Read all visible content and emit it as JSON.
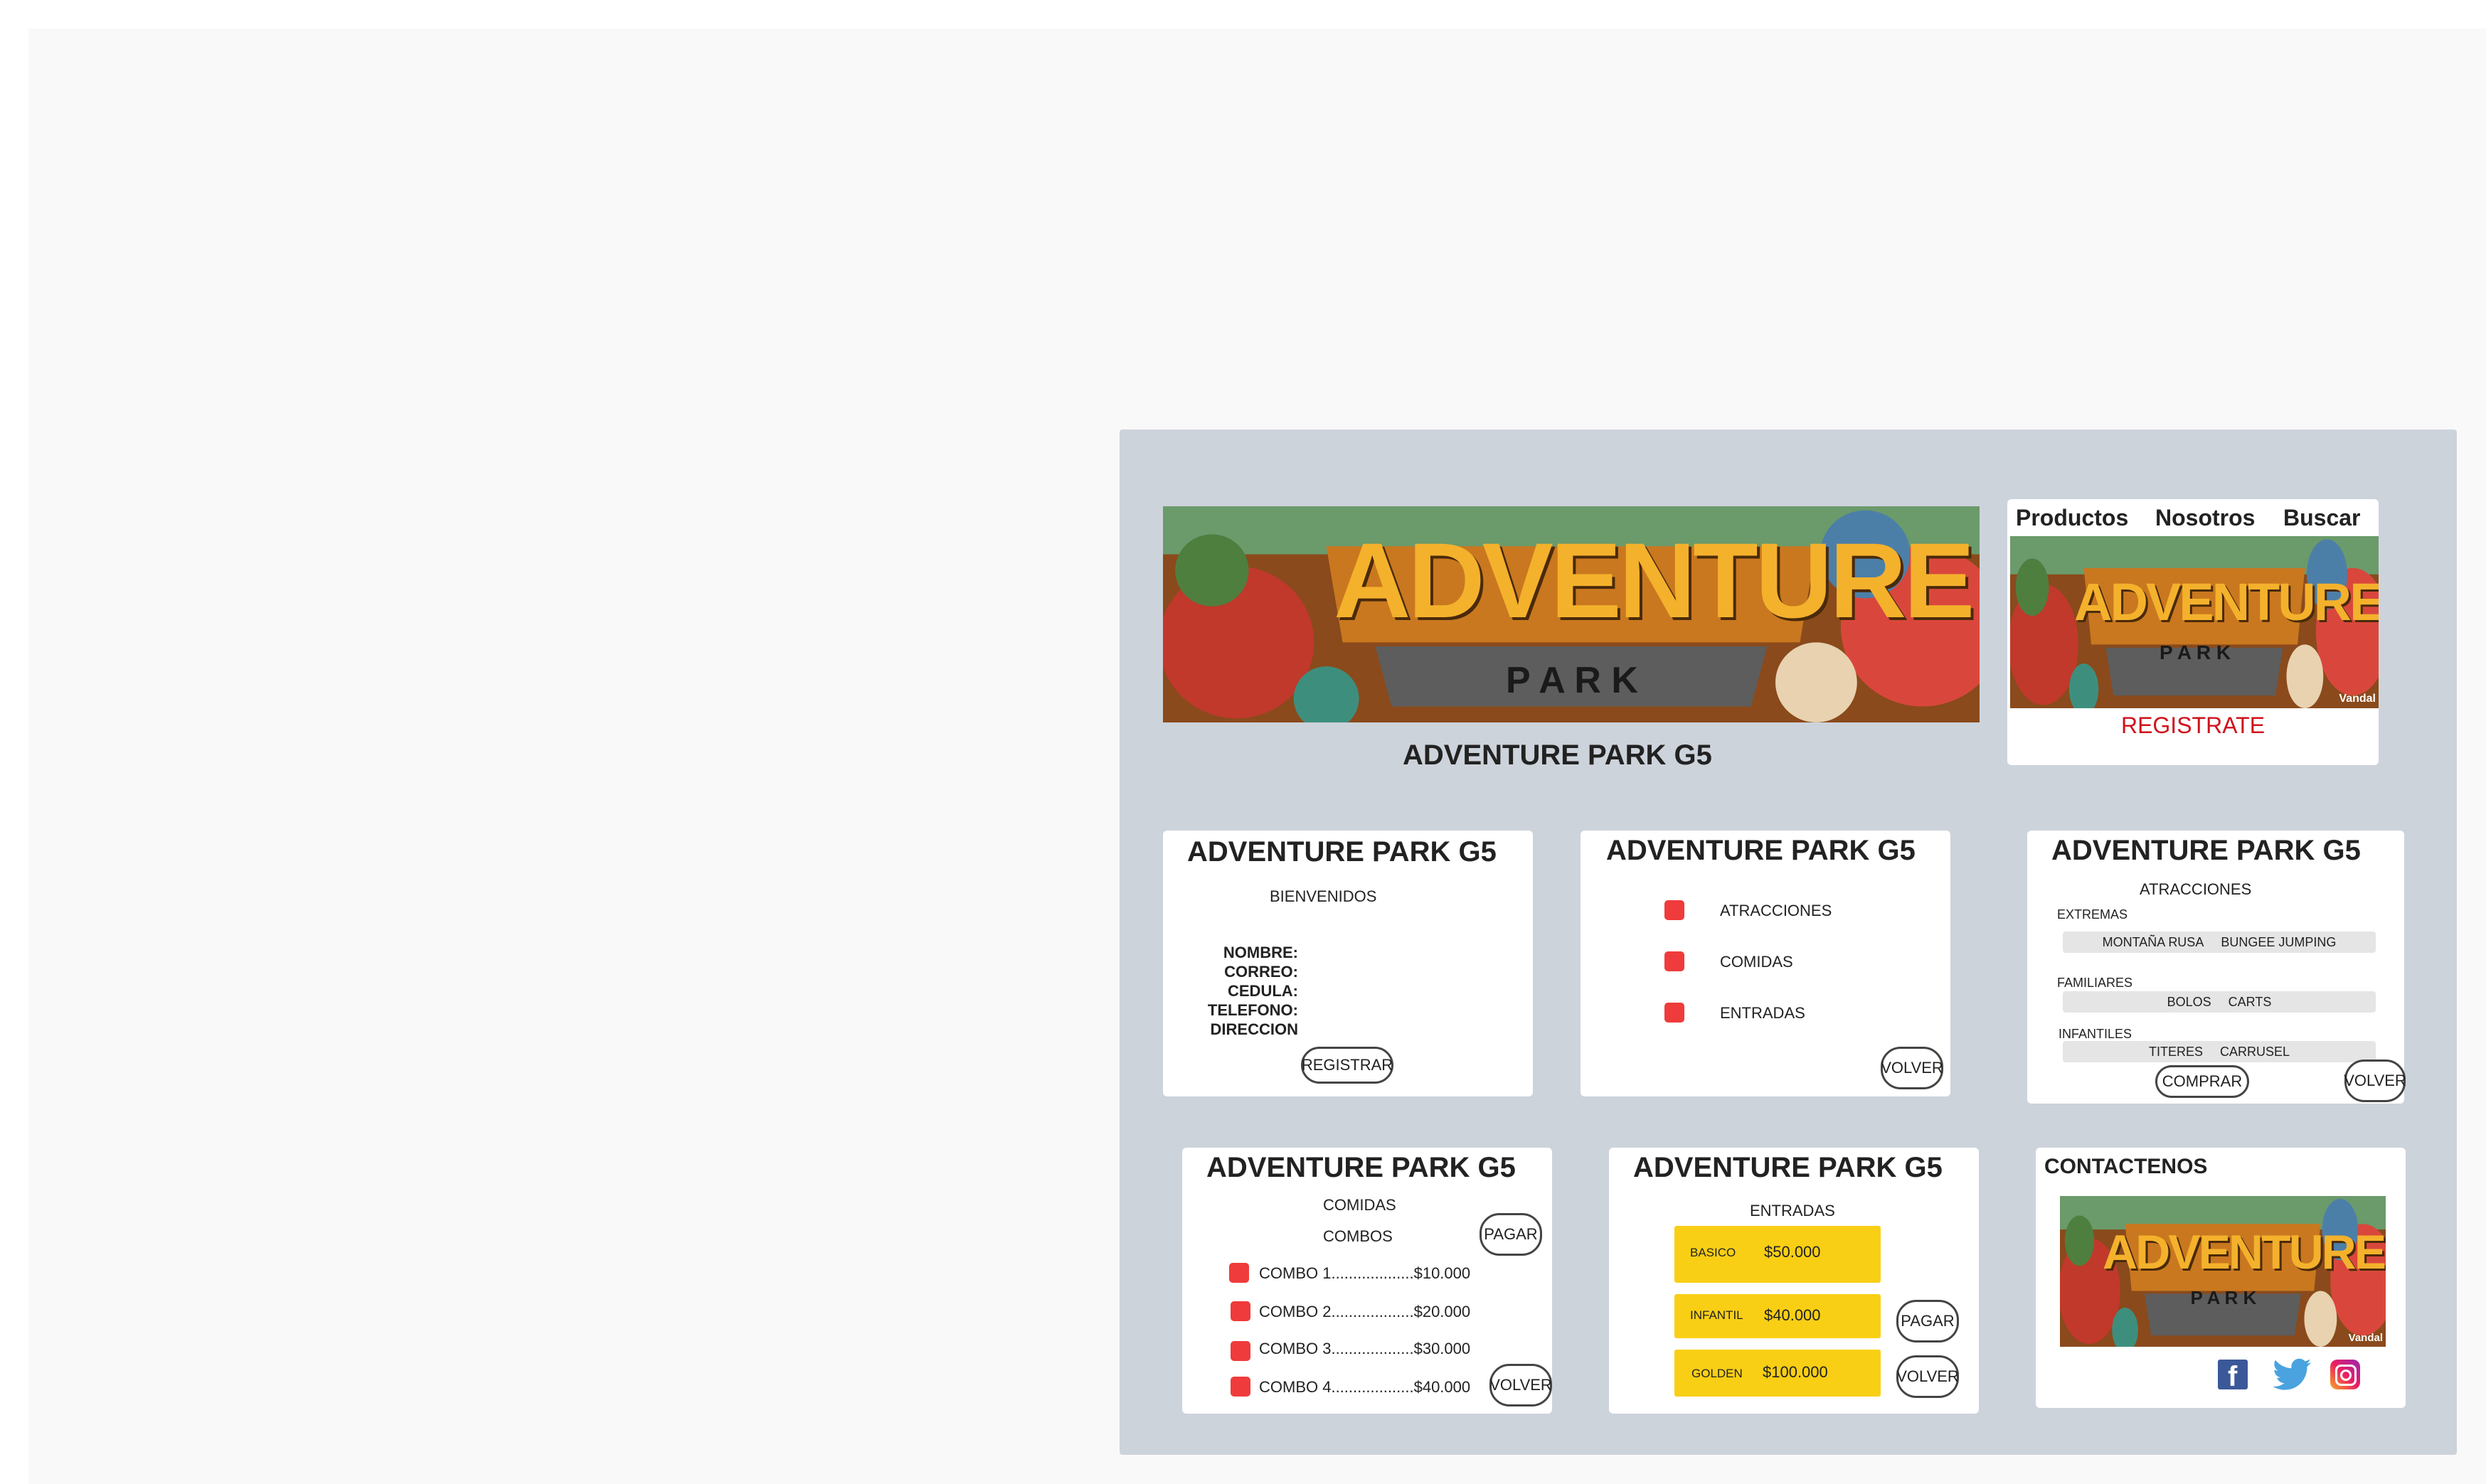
{
  "site_name": "ADVENTURE PARK G5",
  "banner": {
    "logo_main": "ADVENTURE",
    "logo_sub": "P A R K",
    "watermark": "Vandal"
  },
  "nav": {
    "productos": "Productos",
    "nosotros": "Nosotros",
    "buscar": "Buscar"
  },
  "register_link": "REGISTRATE",
  "registro": {
    "welcome": "BIENVENIDOS",
    "fields": [
      "NOMBRE:",
      "CORREO:",
      "CEDULA:",
      "TELEFONO:",
      "DIRECCION"
    ],
    "button": "REGISTRAR"
  },
  "menu": {
    "items": [
      "ATRACCIONES",
      "COMIDAS",
      "ENTRADAS"
    ],
    "back_button": "VOLVER"
  },
  "atracciones": {
    "heading": "ATRACCIONES",
    "extremas": {
      "label": "EXTREMAS",
      "items": [
        "MONTAÑA RUSA",
        "BUNGEE JUMPING"
      ]
    },
    "familiares": {
      "label": "FAMILIARES",
      "items": [
        "BOLOS",
        "CARTS"
      ]
    },
    "infantiles": {
      "label": "INFANTILES",
      "items": [
        "TITERES",
        "CARRUSEL"
      ]
    },
    "buy_button": "COMPRAR",
    "back_button": "VOLVER"
  },
  "comidas": {
    "heading": "COMIDAS",
    "subheading": "COMBOS",
    "combos": [
      "COMBO 1...................$10.000",
      "COMBO 2...................$20.000",
      "COMBO 3...................$30.000",
      "COMBO 4...................$40.000"
    ],
    "pay_button": "PAGAR",
    "back_button": "VOLVER"
  },
  "entradas": {
    "heading": "ENTRADAS",
    "tickets": [
      {
        "name": "BASICO",
        "price": "$50.000"
      },
      {
        "name": "INFANTIL",
        "price": "$40.000"
      },
      {
        "name": "GOLDEN",
        "price": "$100.000"
      }
    ],
    "pay_button": "PAGAR",
    "back_button": "VOLVER"
  },
  "contacto": {
    "heading": "CONTACTENOS",
    "social": [
      "facebook-icon",
      "twitter-icon",
      "instagram-icon"
    ]
  },
  "colors": {
    "board": "#cdd3db",
    "accent_red": "#ef3b3b",
    "gold": "#f9cf15",
    "link_red": "#d0121b"
  }
}
